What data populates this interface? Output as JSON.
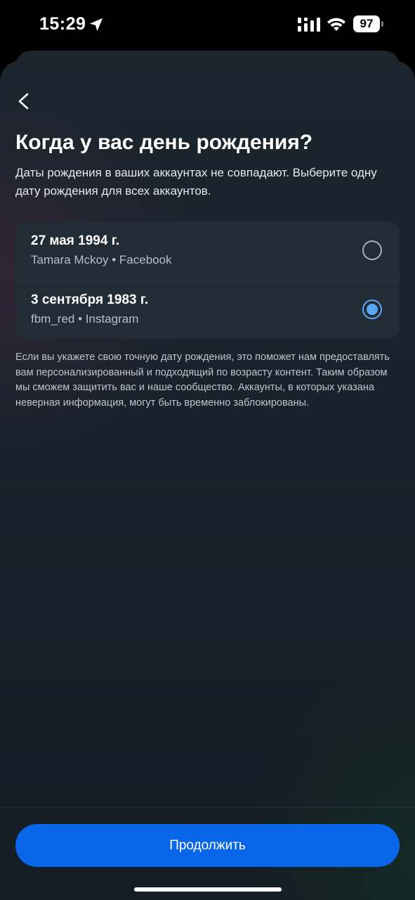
{
  "status_bar": {
    "time": "15:29",
    "battery": "97",
    "icons": [
      "location-arrow-icon",
      "cellular-signal-icon",
      "wifi-icon",
      "battery-icon"
    ]
  },
  "header": {
    "back_icon": "chevron-left-icon"
  },
  "title": "Когда у вас день рождения?",
  "subtitle": "Даты рождения в ваших аккаунтах не совпадают. Выберите одну дату рождения для всех аккаунтов.",
  "options": [
    {
      "date": "27 мая 1994 г.",
      "account": "Tamara Mckoy • Facebook",
      "selected": false
    },
    {
      "date": "3 сентября 1983 г.",
      "account": "fbm_red • Instagram",
      "selected": true
    }
  ],
  "disclaimer": "Если вы укажете свою точную дату рождения, это поможет нам предоставлять вам персонализированный и подходящий по возрасту контент. Таким образом мы сможем защитить вас и наше сообщество. Аккаунты, в которых указана неверная информация, могут быть временно заблокированы.",
  "continue_label": "Продолжить",
  "colors": {
    "accent": "#0a66e8",
    "radio_selected": "#5aa8f5",
    "background": "#18222a",
    "card": "#222c35"
  }
}
